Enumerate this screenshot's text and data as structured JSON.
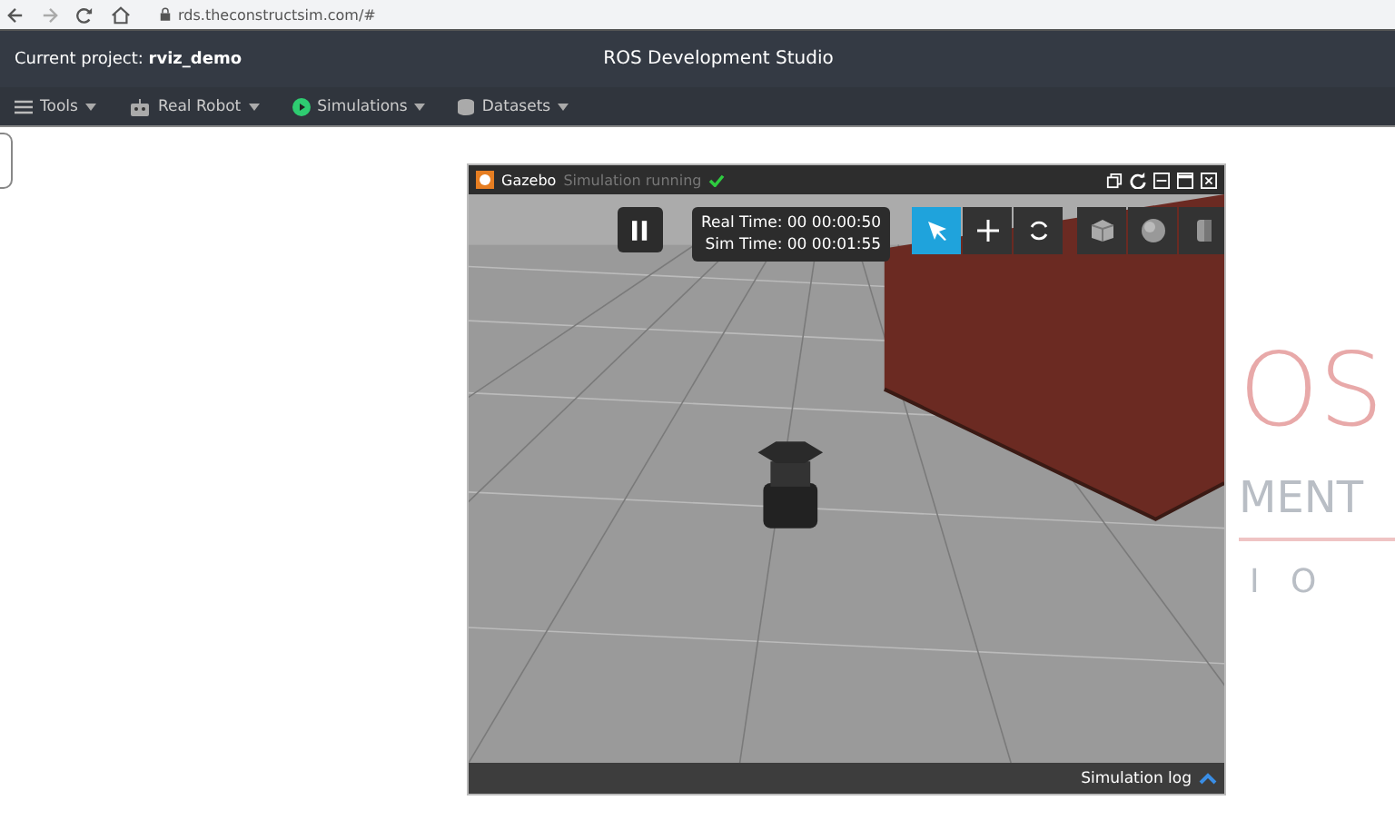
{
  "browser": {
    "url": "rds.theconstructsim.com/#"
  },
  "header": {
    "project_label": "Current project:",
    "project_name": "rviz_demo",
    "title": "ROS Development Studio"
  },
  "nav": [
    {
      "label": "Tools",
      "kind": "menu"
    },
    {
      "label": "Real Robot",
      "kind": "robot"
    },
    {
      "label": "Simulations",
      "kind": "play"
    },
    {
      "label": "Datasets",
      "kind": "database"
    }
  ],
  "background_logo": {
    "letters": "OS",
    "word": "MENT",
    "spaced": "I   O"
  },
  "gazebo": {
    "title": "Gazebo",
    "status": "Simulation running",
    "real_time": "Real Time: 00 00:00:50",
    "sim_time": "Sim Time: 00 00:01:55",
    "tools": [
      {
        "kind": "select",
        "selected": true
      },
      {
        "kind": "move",
        "selected": false
      },
      {
        "kind": "rotate",
        "selected": false
      }
    ],
    "shapes": [
      {
        "kind": "box"
      },
      {
        "kind": "sphere"
      },
      {
        "kind": "cylinder"
      }
    ],
    "log": "Simulation log"
  }
}
